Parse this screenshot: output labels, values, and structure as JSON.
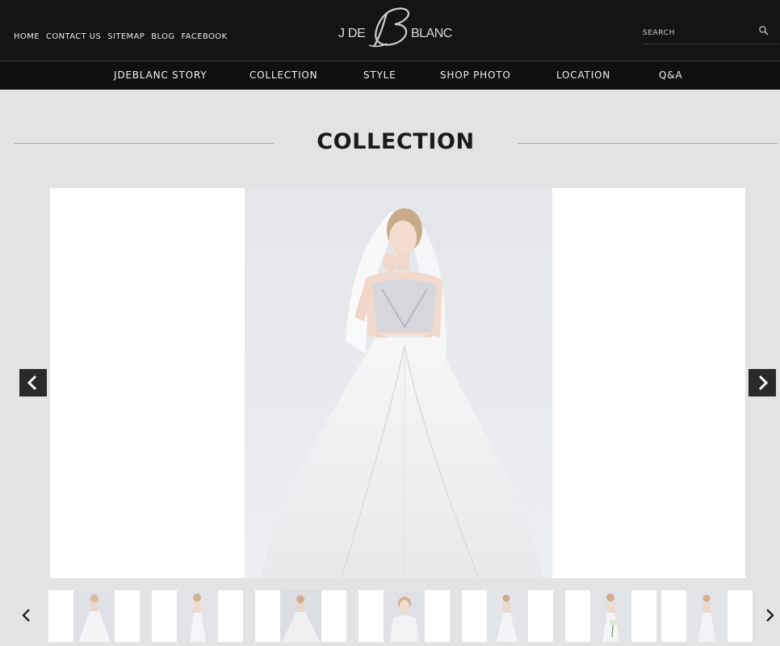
{
  "header": {
    "top_links": [
      "HOME",
      "CONTACT US",
      "SITEMAP",
      "BLOG",
      "FACEBOOK"
    ],
    "logo": {
      "left": "J DE",
      "right": "BLANC"
    },
    "search": {
      "placeholder": "SEARCH",
      "value": ""
    }
  },
  "nav": {
    "items": [
      "JDEBLANC STORY",
      "COLLECTION",
      "STYLE",
      "SHOP PHOTO",
      "LOCATION",
      "Q&A"
    ]
  },
  "main": {
    "title": "COLLECTION"
  },
  "gallery": {
    "thumbnail_count": 7,
    "active_index": 0
  },
  "colors": {
    "header_bg": "#141414",
    "nav_bg": "#101010",
    "page_bg": "#e3e3e3",
    "panel_bg": "#ffffff",
    "arrow_bg": "#2a2a2a"
  },
  "icons": {
    "search": "search-icon",
    "prev": "chevron-left-icon",
    "next": "chevron-right-icon"
  }
}
